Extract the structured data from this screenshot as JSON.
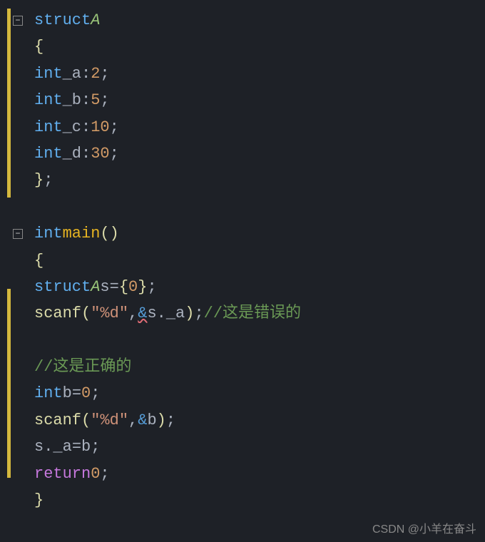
{
  "chart_data": null,
  "code": {
    "struct_keyword": "struct",
    "struct_name": "A",
    "open_brace": "{",
    "close_brace": "}",
    "close_brace_semi": ";",
    "fields": [
      {
        "type": "int",
        "name": "_a",
        "bits": "2"
      },
      {
        "type": "int",
        "name": "_b",
        "bits": "5"
      },
      {
        "type": "int",
        "name": "_c",
        "bits": "10"
      },
      {
        "type": "int",
        "name": "_d",
        "bits": "30"
      }
    ],
    "main_return_type": "int",
    "main_name": "main",
    "parens": "()",
    "decl_s": {
      "struct_kw": "struct",
      "type": "A",
      "name": "s",
      "eq": "=",
      "open": "{",
      "zero": "0",
      "close": "}",
      "semi": ";"
    },
    "scanf1": {
      "func": "scanf",
      "open": "(",
      "fmt": "\"%d\"",
      "comma": ",",
      "amp": "&",
      "arg": "s._a",
      "close": ")",
      "semi": ";",
      "comment": "//这是错误的"
    },
    "comment_correct": "//这是正确的",
    "decl_b": {
      "type": "int",
      "name": "b",
      "eq": "=",
      "val": "0",
      "semi": ";"
    },
    "scanf2": {
      "func": "scanf",
      "open": "(",
      "fmt": "\"%d\"",
      "comma": ",",
      "amp": "&",
      "arg": "b",
      "close": ")",
      "semi": ";"
    },
    "assign": {
      "lhs": "s._a",
      "eq": "=",
      "rhs": "b",
      "semi": ";"
    },
    "return_stmt": {
      "kw": "return",
      "val": "0",
      "semi": ";"
    }
  },
  "fold_symbol": "−",
  "watermark": "CSDN @小羊在奋斗"
}
